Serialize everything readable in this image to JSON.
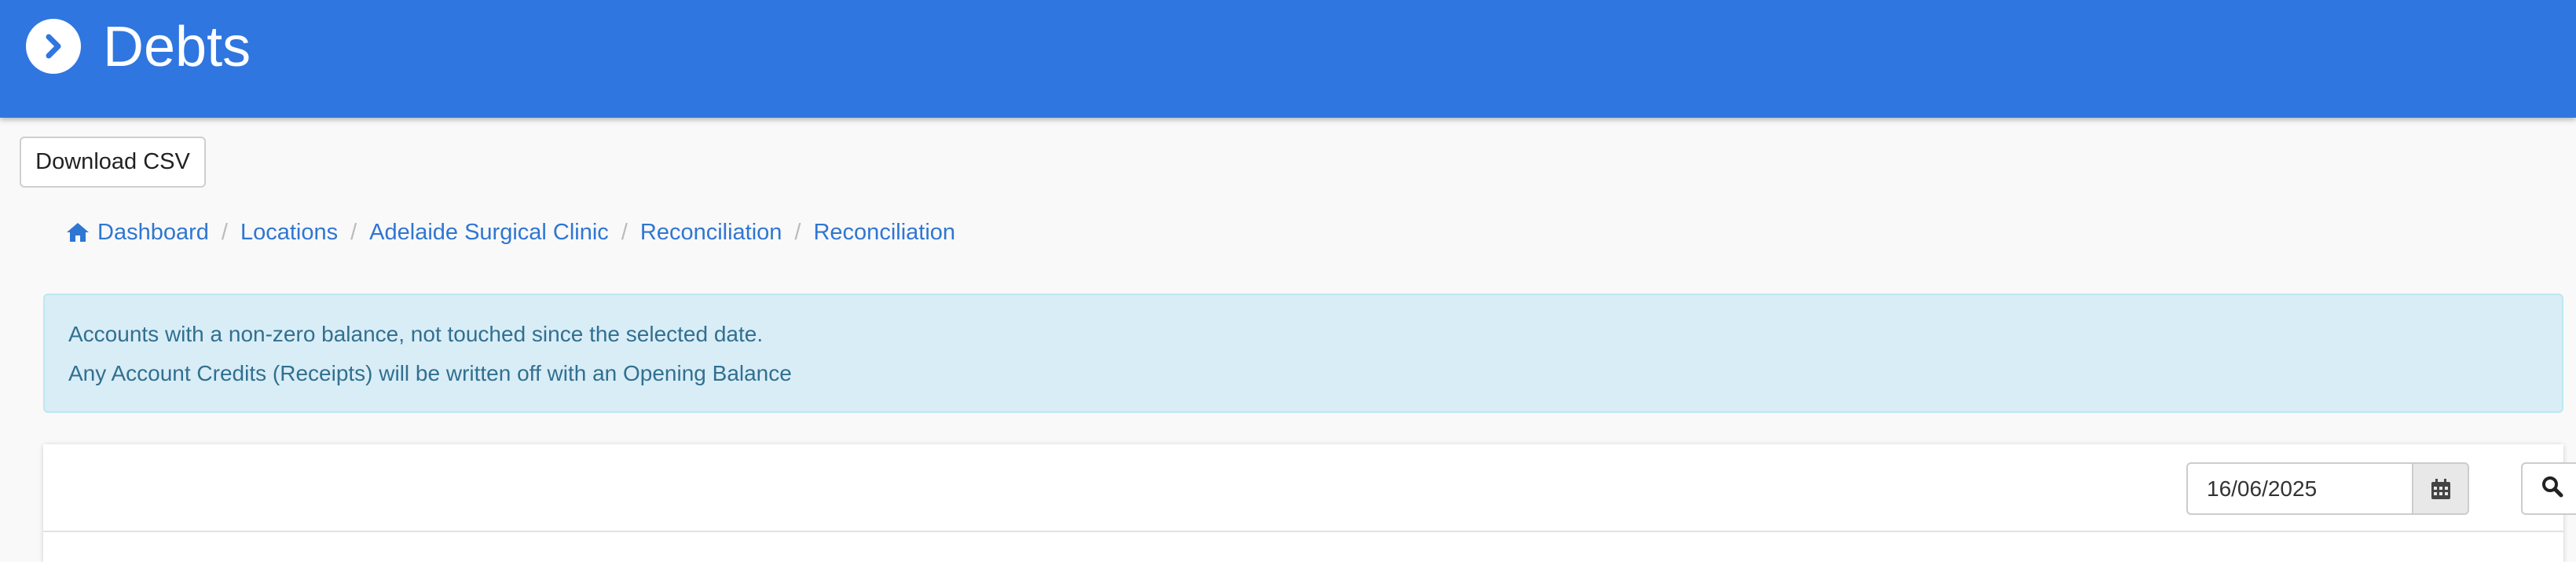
{
  "header": {
    "title": "Debts",
    "icon": "chevron-right-circle-icon",
    "color": "#2f76e0"
  },
  "toolbar": {
    "download_csv_label": "Download CSV"
  },
  "breadcrumb": [
    {
      "label": "Dashboard",
      "icon": "home-icon"
    },
    {
      "label": "Locations"
    },
    {
      "label": "Adelaide Surgical Clinic"
    },
    {
      "label": "Reconciliation"
    },
    {
      "label": "Reconciliation"
    }
  ],
  "alert": {
    "line1": "Accounts with a non-zero balance, not touched since the selected date.",
    "line2": "Any Account Credits (Receipts) will be written off with an Opening Balance"
  },
  "filter": {
    "date_value": "16/06/2025",
    "calendar_icon": "calendar-icon",
    "search_icon": "search-icon"
  }
}
